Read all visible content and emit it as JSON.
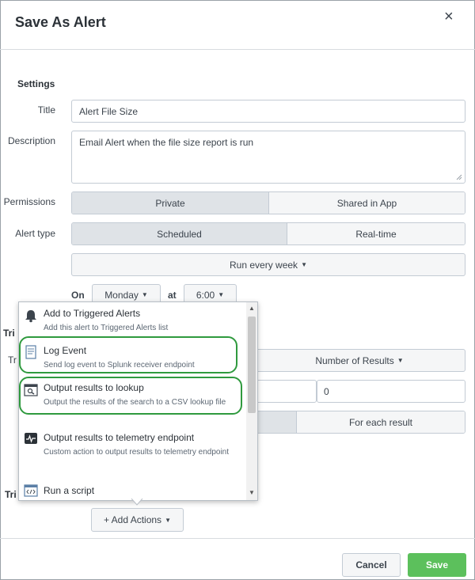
{
  "dialog": {
    "title": "Save As Alert",
    "close_glyph": "×"
  },
  "settings": {
    "heading": "Settings",
    "title_label": "Title",
    "title_value": "Alert File Size",
    "description_label": "Description",
    "description_value": "Email Alert when the file size report is run",
    "permissions_label": "Permissions",
    "permissions_options": [
      "Private",
      "Shared in App"
    ],
    "permissions_selected": "Private",
    "alert_type_label": "Alert type",
    "alert_type_options": [
      "Scheduled",
      "Real-time"
    ],
    "alert_type_selected": "Scheduled",
    "schedule_value": "Run every week",
    "on_label": "On",
    "day_value": "Monday",
    "at_label": "at",
    "time_value": "6:00"
  },
  "trigger": {
    "condition_value": "Number of Results",
    "count_value": "0",
    "trigger_option": "For each result",
    "trigger_label_partial": "Tri",
    "trigger_label_partial2": "Tr",
    "trigger_label_partial3": "Tri"
  },
  "actions_menu": {
    "items": [
      {
        "name": "Add to Triggered Alerts",
        "desc": "Add this alert to Triggered Alerts list",
        "icon": "bell-icon"
      },
      {
        "name": "Log Event",
        "desc": "Send log event to Splunk receiver endpoint",
        "icon": "log-document-icon"
      },
      {
        "name": "Output results to lookup",
        "desc": "Output the results of the search to a CSV lookup file",
        "icon": "lookup-window-icon"
      },
      {
        "name": "Output results to telemetry endpoint",
        "desc": "Custom action to output results to telemetry endpoint",
        "icon": "telemetry-pulse-icon"
      },
      {
        "name": "Run a script",
        "desc": "",
        "icon": "script-window-icon"
      }
    ],
    "highlight_color": "#2f9a3e"
  },
  "add_actions_label": "+ Add Actions",
  "footer": {
    "cancel_label": "Cancel",
    "save_label": "Save"
  },
  "colors": {
    "save": "#5cc05c",
    "active_segment": "#dfe3e7"
  }
}
